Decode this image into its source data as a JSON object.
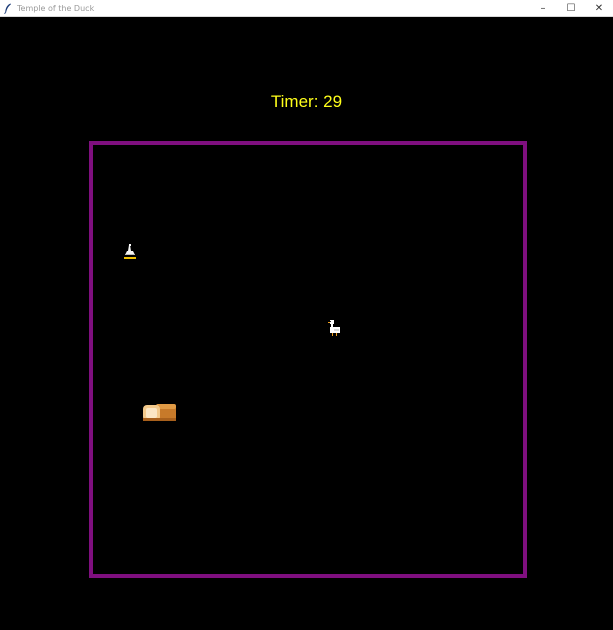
{
  "window": {
    "title": "Temple of the Duck",
    "controls": {
      "minimize": "–",
      "maximize": "☐",
      "close": "✕"
    }
  },
  "hud": {
    "timer_label": "Timer:",
    "timer_value": "29"
  },
  "colors": {
    "background": "#000000",
    "arena_border": "#7f0f7f",
    "timer_text": "#ffff1a"
  },
  "sprites": [
    {
      "name": "wizard-hat-item",
      "icon": "hat-icon"
    },
    {
      "name": "duck-player",
      "icon": "duck-icon"
    },
    {
      "name": "bread-loaf-item",
      "icon": "bread-icon"
    }
  ]
}
